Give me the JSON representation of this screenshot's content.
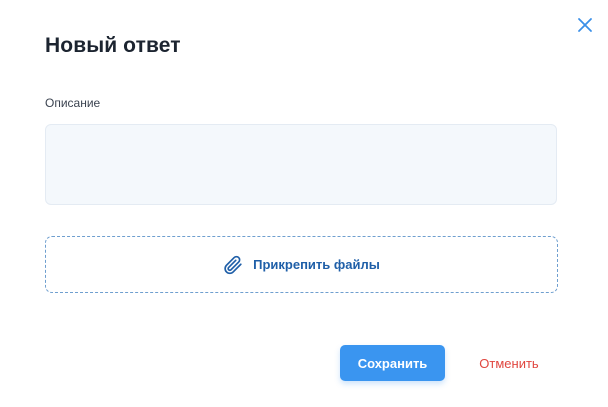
{
  "dialog": {
    "title": "Новый ответ",
    "close_icon": "close-icon"
  },
  "form": {
    "description_label": "Описание",
    "description_value": "",
    "attach_label": "Прикрепить файлы",
    "attach_icon": "paperclip-icon"
  },
  "actions": {
    "save_label": "Сохранить",
    "cancel_label": "Отменить"
  },
  "colors": {
    "primary": "#3a95f0",
    "danger": "#e0463f",
    "link": "#1f5fa8"
  }
}
